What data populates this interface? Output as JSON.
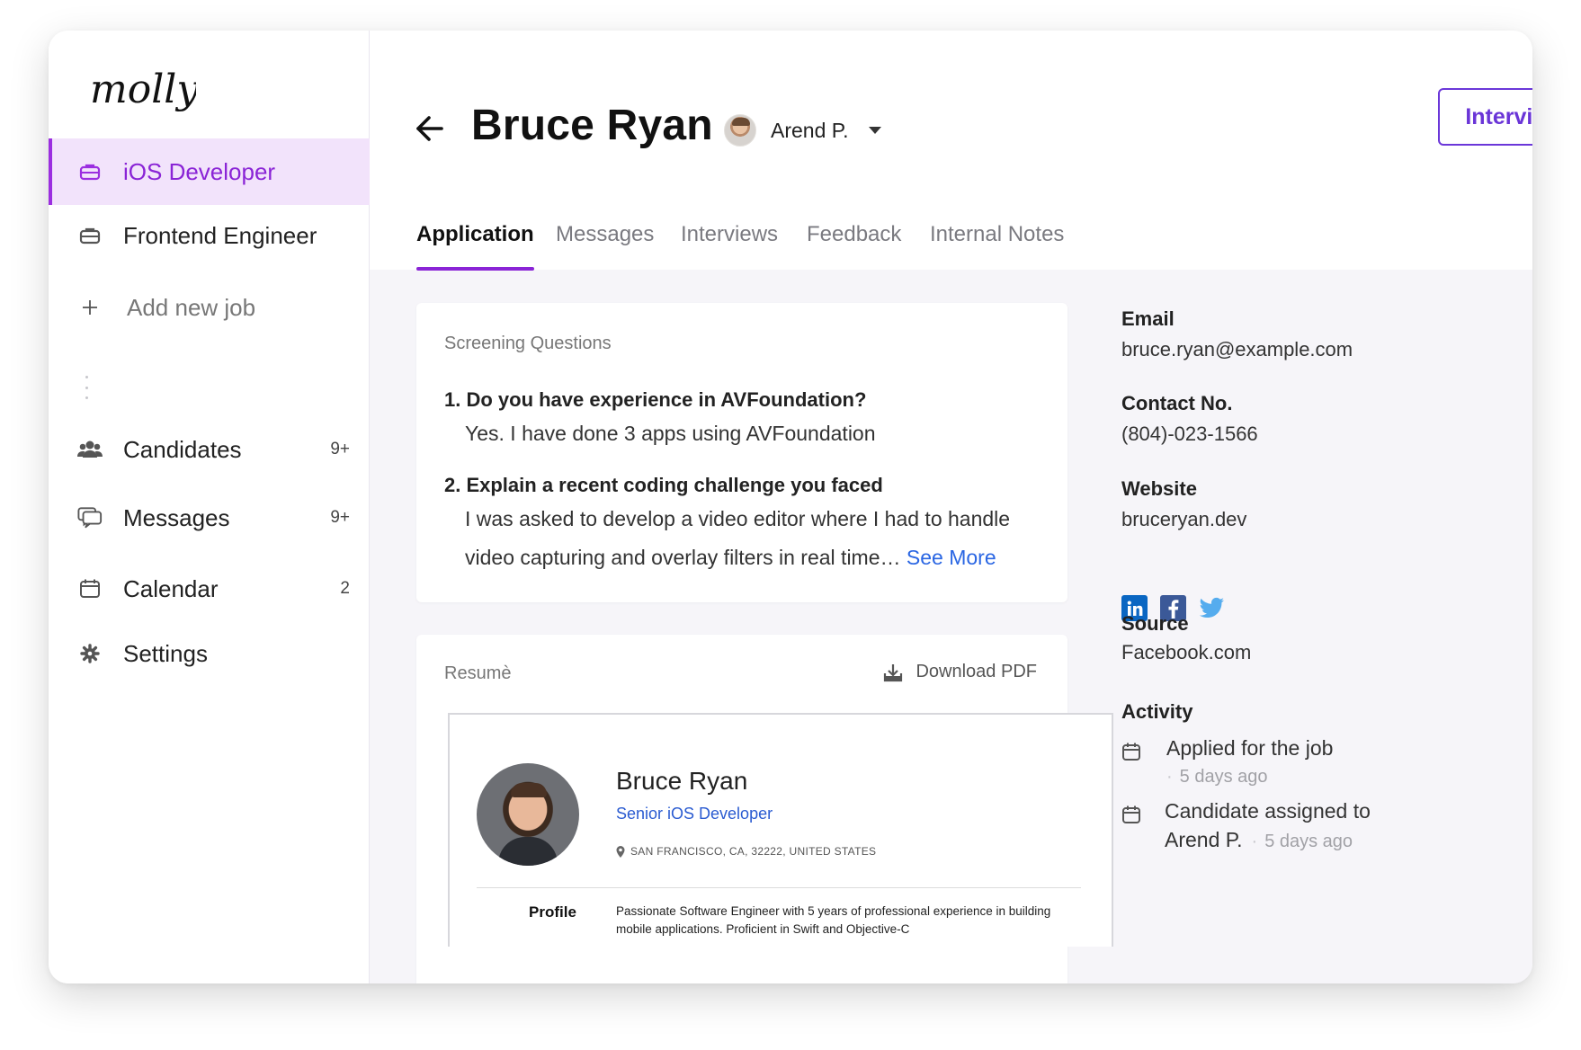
{
  "brand": {
    "logo_text": "molly"
  },
  "sidebar": {
    "jobs": [
      {
        "label": "iOS Developer",
        "active": true
      },
      {
        "label": "Frontend Engineer",
        "active": false
      }
    ],
    "add_job_label": "Add new job",
    "nav": [
      {
        "label": "Candidates",
        "count": "9+",
        "icon": "people-icon"
      },
      {
        "label": "Messages",
        "count": "9+",
        "icon": "chat-bubbles-icon"
      },
      {
        "label": "Calendar",
        "count": "2",
        "icon": "calendar-icon"
      },
      {
        "label": "Settings",
        "count": "",
        "icon": "gear-icon"
      }
    ]
  },
  "header": {
    "candidate_name": "Bruce Ryan",
    "assignee": "Arend P.",
    "primary_action": "Interview"
  },
  "tabs": [
    "Application",
    "Messages",
    "Interviews",
    "Feedback",
    "Internal Notes"
  ],
  "active_tab": "Application",
  "screening": {
    "title": "Screening Questions",
    "questions": [
      {
        "q": "1. Do you have experience in AVFoundation?",
        "a": "Yes. I have done 3 apps using AVFoundation"
      },
      {
        "q": "2. Explain a recent coding challenge you faced",
        "a_line1": "I was asked to develop a video editor where I had to handle",
        "a_line2": "video capturing and overlay filters in real time…",
        "see_more": "See More"
      }
    ]
  },
  "resume": {
    "title": "Resumè",
    "download_label": "Download PDF",
    "name": "Bruce Ryan",
    "role": "Senior iOS Developer",
    "location": "SAN FRANCISCO, CA, 32222, UNITED STATES",
    "profile_label": "Profile",
    "profile_text": "Passionate Software Engineer with 5 years of professional experience in building mobile applications. Proficient in Swift and Objective-C"
  },
  "details": {
    "email_label": "Email",
    "email": "bruce.ryan@example.com",
    "contact_label": "Contact No.",
    "contact": "(804)-023-1566",
    "website_label": "Website",
    "website": "bruceryan.dev",
    "socials": [
      "linkedin",
      "facebook",
      "twitter"
    ],
    "source_label": "Source",
    "source": "Facebook.com",
    "activity_label": "Activity",
    "activity": [
      {
        "text": "Applied for the job",
        "time": "5 days ago"
      },
      {
        "text_line1": "Candidate assigned to",
        "text_line2": "Arend P.",
        "time": "5 days ago"
      }
    ]
  },
  "colors": {
    "accent": "#8a24d6",
    "accent_bg": "#f2e3fb",
    "button": "#6a35d7",
    "link": "#2a66e3",
    "linkedin": "#0a66c2",
    "facebook": "#3b5998",
    "twitter": "#55acee"
  }
}
